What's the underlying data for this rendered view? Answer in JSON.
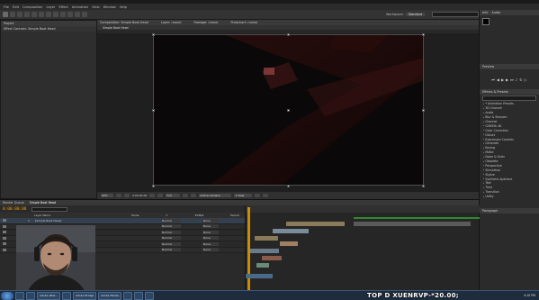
{
  "menu": [
    "File",
    "Edit",
    "Composition",
    "Layer",
    "Effect",
    "Animation",
    "View",
    "Window",
    "Help"
  ],
  "toolbar": {
    "workspace_label": "Workspace:",
    "workspace_value": "Standard",
    "search_placeholder": "Search Help"
  },
  "project_panel": {
    "tab": "Project",
    "effect_controls_tab": "Effect Controls: Simple Boat Head"
  },
  "composition_panel": {
    "tab": "Composition: Simple Boat Head",
    "layer_tab": "Layer: (none)",
    "footage_tab": "Footage: (none)",
    "flowchart_tab": "Flowchart: (none)",
    "comp_name": "Simple Boat Head",
    "zoom": "50%",
    "resolution": "Full",
    "view": "Active Camera",
    "views": "1 View",
    "timecode": "0:00:00:00"
  },
  "info_panel": {
    "tab": "Info",
    "audio_tab": "Audio"
  },
  "preview_panel": {
    "tab": "Preview"
  },
  "effects_panel": {
    "tab": "Effects & Presets",
    "search_value": "",
    "items": [
      "* Animation Presets",
      "3D Channel",
      "Audio",
      "Blur & Sharpen",
      "Channel",
      "CINEMA 4D",
      "Color Correction",
      "Distort",
      "Expression Controls",
      "Generate",
      "Keying",
      "Matte",
      "Noise & Grain",
      "Obsolete",
      "Perspective",
      "Simulation",
      "Stylize",
      "Synthetic Aperture",
      "Text",
      "Time",
      "Transition",
      "Utility"
    ]
  },
  "paragraph_panel": {
    "tab": "Paragraph"
  },
  "timeline": {
    "tabs": [
      "Render Queue",
      "Simple Boat Head"
    ],
    "timecode": "0:00:00:00",
    "columns": [
      "Layer Name",
      "Mode",
      "T",
      "TrkMat",
      "Parent"
    ],
    "layers": [
      {
        "num": "1",
        "name": "[Simple Boat Head]",
        "mode": "Normal",
        "parent": "None"
      },
      {
        "num": "2",
        "name": "Layer 2",
        "mode": "Normal",
        "parent": "None"
      },
      {
        "num": "3",
        "name": "Layer 3",
        "mode": "Normal",
        "parent": "None"
      },
      {
        "num": "4",
        "name": "Layer 4",
        "mode": "Normal",
        "parent": "None"
      },
      {
        "num": "5",
        "name": "Layer 5",
        "mode": "Normal",
        "parent": "None"
      },
      {
        "num": "6",
        "name": "Layer 6",
        "mode": "Normal",
        "parent": "None"
      }
    ]
  },
  "taskbar": {
    "tasks": [
      "",
      "",
      "Adobe After...",
      "",
      "Adobe Bridge",
      "Adobe Media...",
      "",
      "",
      ""
    ],
    "clock": "4:10 PM"
  },
  "watermark": "TOP D XUENRVP-*20.00;",
  "colors": {
    "accent": "#e8a000",
    "selection": "#2d4663",
    "timeline_bar": "#8b7a5a"
  }
}
